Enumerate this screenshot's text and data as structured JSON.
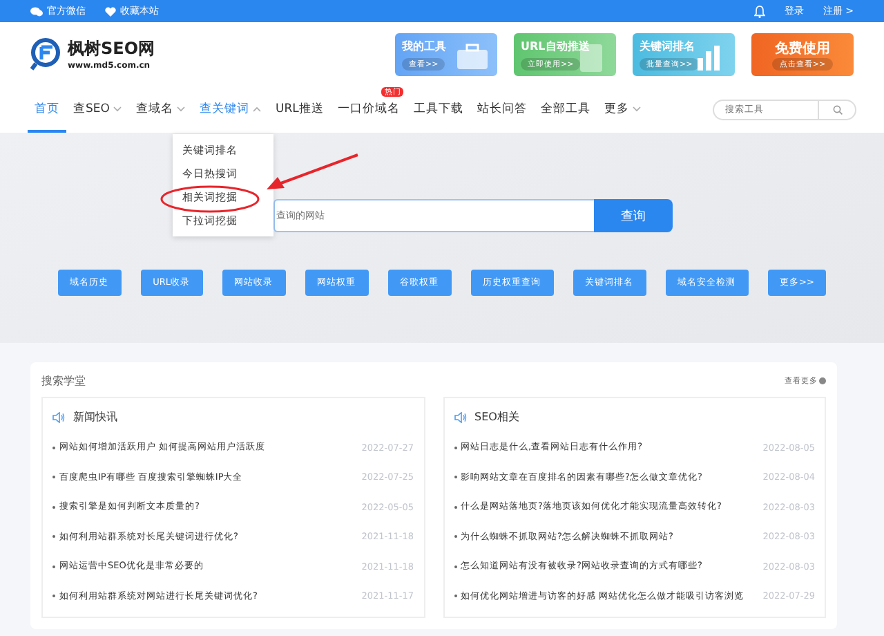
{
  "top_bar": {
    "left_links": [
      "官方微信",
      "收藏本站"
    ],
    "login": "登录",
    "register": "注册 >"
  },
  "header": {
    "logo_name": "枫树SEO网",
    "logo_url": "www.md5.com.cn",
    "banners": [
      {
        "kind": "toolbox",
        "title": "我的工具",
        "action": "查看>>"
      },
      {
        "kind": "url",
        "title": "URL自动推送",
        "action": "立即使用>>"
      },
      {
        "kind": "chart",
        "title": "关键词排名",
        "action": "批量查询>>"
      },
      {
        "kind": "promo",
        "title": "免费使用",
        "action": "点击查看>>"
      }
    ]
  },
  "nav": {
    "items": [
      {
        "label": "首页",
        "selected": true,
        "has_menu": false,
        "expanded": false
      },
      {
        "label": "查SEO",
        "selected": false,
        "has_menu": true,
        "expanded": false
      },
      {
        "label": "查域名",
        "selected": false,
        "has_menu": true,
        "expanded": false
      },
      {
        "label": "查关键词",
        "selected": false,
        "has_menu": true,
        "expanded": true
      },
      {
        "label": "URL推送",
        "selected": false,
        "has_menu": false,
        "expanded": false
      },
      {
        "label": "一口价域名",
        "selected": false,
        "has_menu": false,
        "expanded": false,
        "badge": "热门"
      },
      {
        "label": "工具下载",
        "selected": false,
        "has_menu": false,
        "expanded": false
      },
      {
        "label": "站长问答",
        "selected": false,
        "has_menu": false,
        "expanded": false
      },
      {
        "label": "全部工具",
        "selected": false,
        "has_menu": false,
        "expanded": false
      },
      {
        "label": "更多",
        "selected": false,
        "has_menu": true,
        "expanded": false
      }
    ],
    "search": {
      "placeholder": "搜索工具"
    }
  },
  "dropdown": {
    "items": [
      {
        "label": "关键词排名",
        "circled": false
      },
      {
        "label": "今日热搜词",
        "circled": false
      },
      {
        "label": "相关词挖掘",
        "circled": true
      },
      {
        "label": "下拉词挖掘",
        "circled": false
      }
    ]
  },
  "hero": {
    "search": {
      "placeholder": "查询的网站"
    },
    "button": "查询",
    "quick_links": [
      "域名历史",
      "URL收录",
      "网站收录",
      "网站权重",
      "谷歌权重",
      "历史权重查询",
      "关键词排名",
      "域名安全检测",
      "更多>>"
    ]
  },
  "school": {
    "title": "搜索学堂",
    "more": "查看更多",
    "panels": [
      {
        "title": "新闻快讯",
        "rows": [
          {
            "text": "网站如何增加活跃用户 如何提高网站用户活跃度",
            "date": "2022-07-27"
          },
          {
            "text": "百度爬虫IP有哪些 百度搜索引擎蜘蛛IP大全",
            "date": "2022-07-25"
          },
          {
            "text": "搜索引擎是如何判断文本质量的?",
            "date": "2022-05-05"
          },
          {
            "text": "如何利用站群系统对长尾关键词进行优化?",
            "date": "2021-11-18"
          },
          {
            "text": "网站运营中SEO优化是非常必要的",
            "date": "2021-11-18"
          },
          {
            "text": "如何利用站群系统对网站进行长尾关键词优化?",
            "date": "2021-11-17"
          }
        ]
      },
      {
        "title": "SEO相关",
        "rows": [
          {
            "text": "网站日志是什么,查看网站日志有什么作用?",
            "date": "2022-08-05"
          },
          {
            "text": "影响网站文章在百度排名的因素有哪些?怎么做文章优化?",
            "date": "2022-08-04"
          },
          {
            "text": "什么是网站落地页?落地页该如何优化才能实现流量高效转化?",
            "date": "2022-08-03"
          },
          {
            "text": "为什么蜘蛛不抓取网站?怎么解决蜘蛛不抓取网站?",
            "date": "2022-08-03"
          },
          {
            "text": "怎么知道网站有没有被收录?网站收录查询的方式有哪些?",
            "date": "2022-08-03"
          },
          {
            "text": "如何优化网站增进与访客的好感 网站优化怎么做才能吸引访客浏览",
            "date": "2022-07-29"
          }
        ]
      }
    ]
  }
}
